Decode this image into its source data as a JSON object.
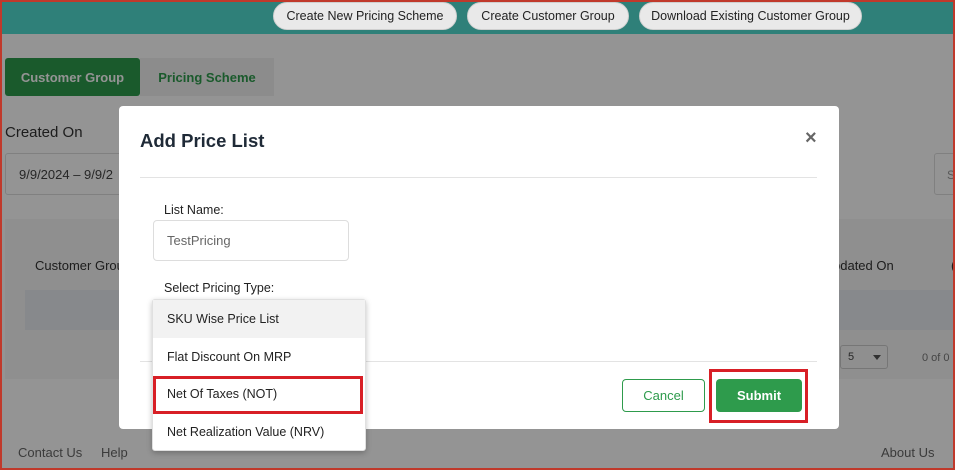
{
  "topbar": {
    "buttons": [
      "Create New Pricing Scheme",
      "Create Customer Group",
      "Download Existing Customer Group"
    ]
  },
  "tabs": [
    "Customer Group",
    "Pricing Scheme"
  ],
  "filters": {
    "created_label": "Created On",
    "date_range": "9/9/2024 – 9/9/2",
    "search_stub": "S"
  },
  "table": {
    "col_customer_group": "Customer Grou",
    "col_updated_on": "pdated On",
    "col_last": "("
  },
  "pagination": {
    "page_size": "5",
    "range_text": "0 of 0"
  },
  "footer": {
    "contact": "Contact Us",
    "help": "Help",
    "about": "About Us"
  },
  "modal": {
    "title": "Add Price List",
    "close": "×",
    "list_name_label": "List Name:",
    "list_name_value": "TestPricing",
    "pricing_type_label": "Select Pricing Type:",
    "cancel_label": "Cancel",
    "submit_label": "Submit"
  },
  "dropdown": {
    "options": [
      "SKU Wise Price List",
      "Flat Discount On MRP",
      "Net Of Taxes (NOT)",
      "Net Realization Value (NRV)"
    ]
  },
  "colors": {
    "topbar": "#2f8079",
    "accent_green": "#2e9b4c",
    "highlight_red": "#d81f26"
  }
}
